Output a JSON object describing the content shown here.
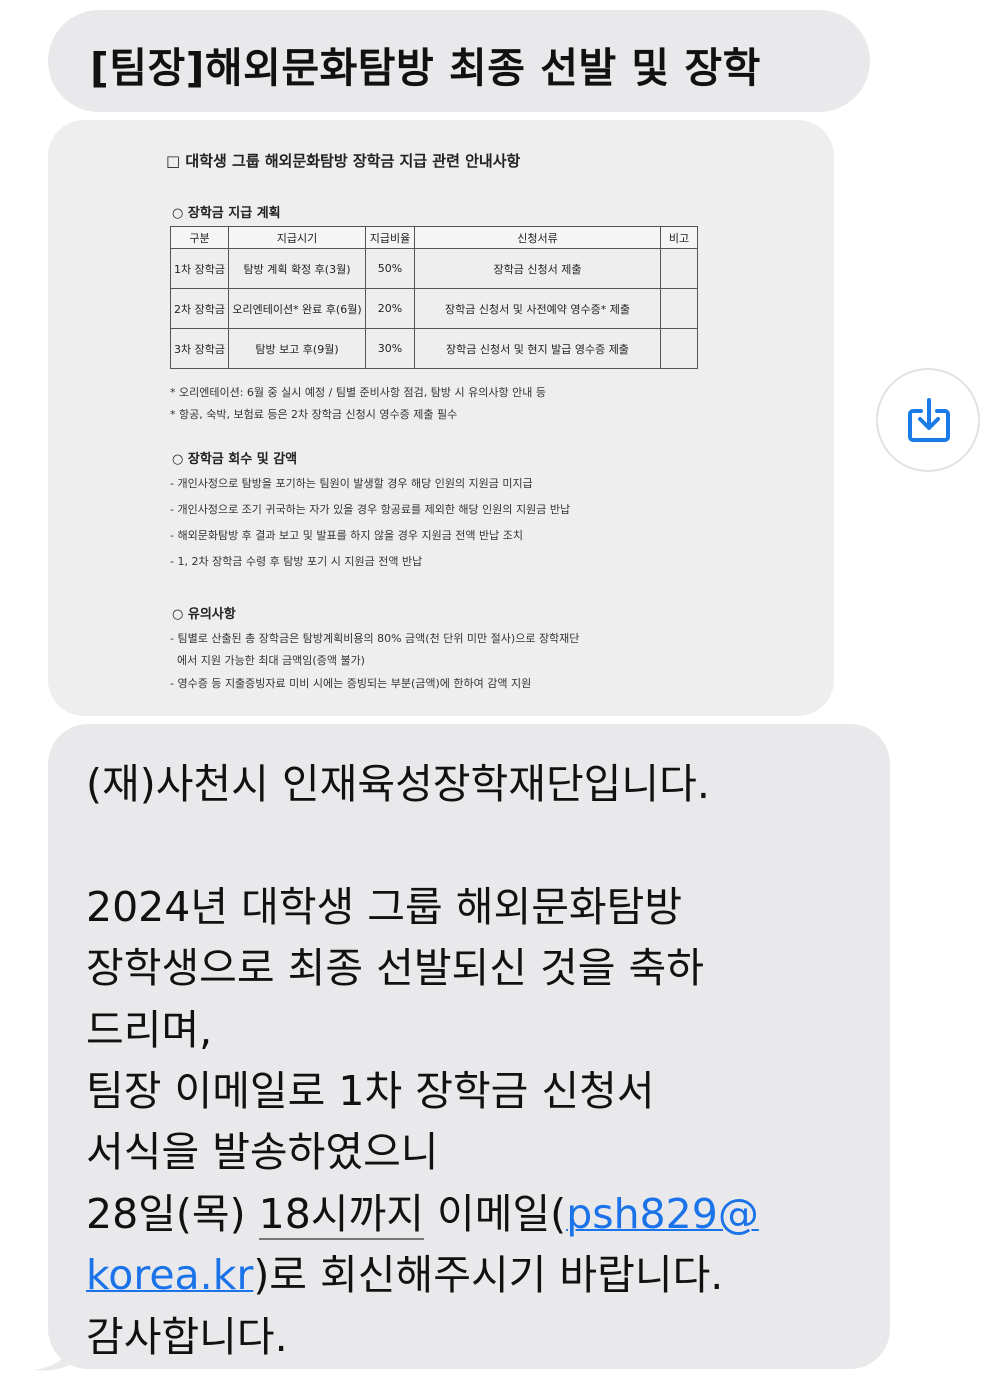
{
  "subject": "[팀장]해외문화탐방 최종 선발 및 장학",
  "attachment": {
    "title": "□ 대학생 그룹 해외문화탐방 장학금 지급 관련 안내사항",
    "section1": "○ 장학금 지급 계획",
    "table": {
      "headers": [
        "구분",
        "지급시기",
        "지급비율",
        "신청서류",
        "비고"
      ],
      "rows": [
        [
          "1차 장학금",
          "탐방 계획 확정 후(3월)",
          "50%",
          "장학금 신청서 제출",
          ""
        ],
        [
          "2차 장학금",
          "오리엔테이션* 완료 후(6월)",
          "20%",
          "장학금 신청서 및 사전예약 영수증* 제출",
          ""
        ],
        [
          "3차 장학금",
          "탐방 보고 후(9월)",
          "30%",
          "장학금 신청서 및 현지 발급 영수증 제출",
          ""
        ]
      ]
    },
    "notes1": [
      "* 오리엔테이션: 6월 중 실시 예정 / 팀별 준비사항 점검, 탐방 시 유의사항 안내 등",
      "* 항공, 숙박, 보험료 등은 2차 장학금 신청시 영수증 제출 필수"
    ],
    "section2": "○ 장학금 회수 및 감액",
    "notes2": [
      "- 개인사정으로 탐방을 포기하는 팀원이 발생할 경우 해당 인원의 지원금 미지급",
      "- 개인사정으로 조기 귀국하는 자가 있을 경우 항공료를 제외한 해당 인원의 지원금 반납",
      "- 해외문화탐방 후 결과 보고 및 발표를 하지 않을 경우 지원금 전액 반납 조치",
      "- 1, 2차 장학금 수령 후 탐방 포기 시 지원금 전액 반납"
    ],
    "section3": "○ 유의사항",
    "notes3": [
      "- 팀별로 산출된 총 장학금은 탐방계획비용의 80% 금액(천 단위 미만 절사)으로 장학재단",
      "  에서 지원 가능한 최대 금액임(증액 불가)",
      "- 영수증 등 지출증빙자료 미비 시에는 증빙되는 부분(금액)에 한하여 감액 지원"
    ]
  },
  "save_icon": "download-tray-icon",
  "message": {
    "line1": "(재)사천시 인재육성장학재단입니다.",
    "line3": "2024년 대학생 그룹 해외문화탐방",
    "line4": "장학생으로 최종 선발되신 것을 축하",
    "line5": "드리며,",
    "line6": "팀장 이메일로  1차 장학금 신청서",
    "line7": "서식을 발송하였으니",
    "line8_a": "28일(목) ",
    "line8_b": "18시까지",
    "line8_c": " 이메일(",
    "line8_link": "psh829@",
    "line9_link": "korea.kr",
    "line9_rest": ")로 회신해주시기 바랍니다.",
    "line10": "감사합니다."
  },
  "colors": {
    "bubble": "#e9e9eb",
    "link": "#1a73e8",
    "icon": "#1a7ae6"
  }
}
